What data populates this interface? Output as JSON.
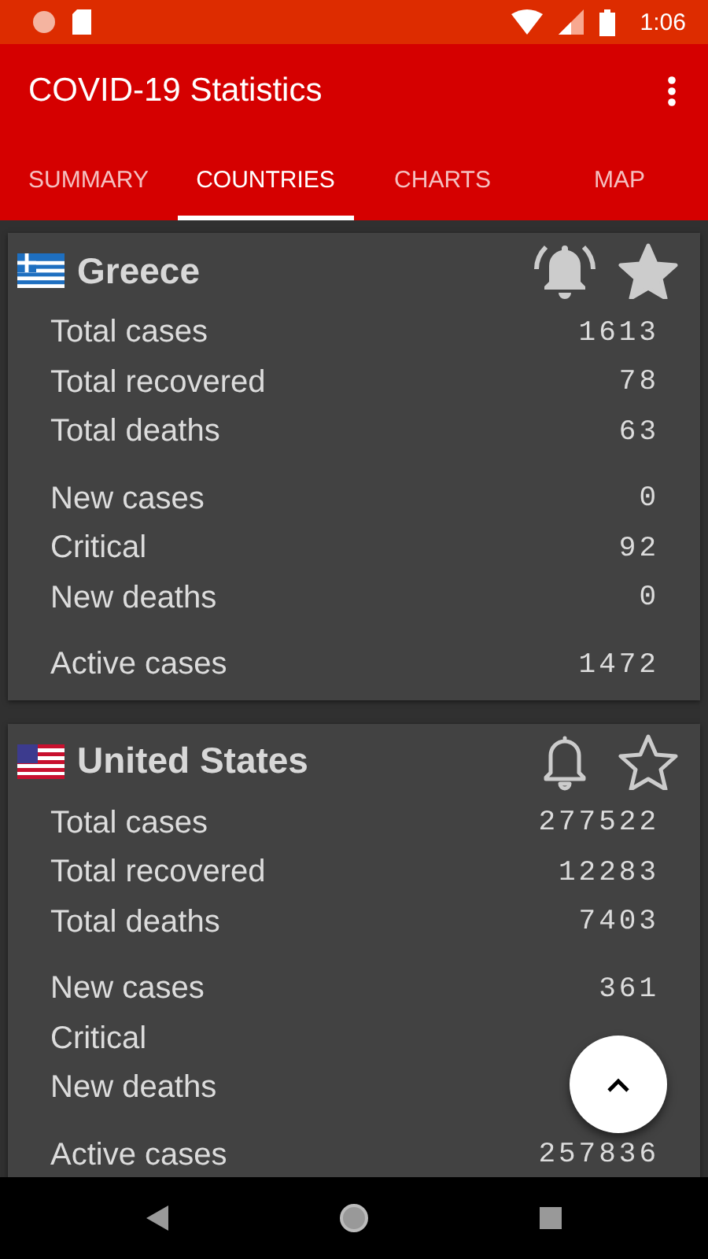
{
  "status_bar": {
    "time": "1:06"
  },
  "app_bar": {
    "title": "COVID-19 Statistics"
  },
  "tabs": [
    {
      "label": "SUMMARY",
      "selected": false
    },
    {
      "label": "COUNTRIES",
      "selected": true
    },
    {
      "label": "CHARTS",
      "selected": false
    },
    {
      "label": "MAP",
      "selected": false
    }
  ],
  "countries": [
    {
      "name": "Greece",
      "kind": "greece",
      "alerts": true,
      "favorite": true,
      "groups": [
        [
          {
            "label": "Total cases",
            "value": "1613"
          },
          {
            "label": "Total recovered",
            "value": "78"
          },
          {
            "label": "Total deaths",
            "value": "63"
          }
        ],
        [
          {
            "label": "New cases",
            "value": "0"
          },
          {
            "label": "Critical",
            "value": "92"
          },
          {
            "label": "New deaths",
            "value": "0"
          }
        ],
        [
          {
            "label": "Active cases",
            "value": "1472"
          }
        ]
      ]
    },
    {
      "name": "United States",
      "kind": "usa",
      "alerts": false,
      "favorite": false,
      "groups": [
        [
          {
            "label": "Total cases",
            "value": "277522"
          },
          {
            "label": "Total recovered",
            "value": "12283"
          },
          {
            "label": "Total deaths",
            "value": "7403"
          }
        ],
        [
          {
            "label": "New cases",
            "value": "361"
          },
          {
            "label": "Critical"
          },
          {
            "label": "New deaths"
          }
        ],
        [
          {
            "label": "Active cases",
            "value": "257836"
          }
        ]
      ]
    }
  ]
}
